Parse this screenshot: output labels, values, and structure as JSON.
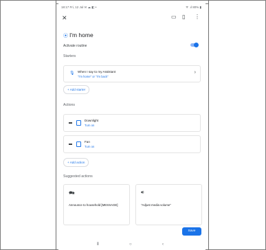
{
  "status_bar": {
    "left": "18:17  Fri, 12 Jul  ✉ ☁ ◧ •",
    "right": "ᯤ .ıl 80% ▮"
  },
  "toolbar": {
    "close_icon": "close-icon",
    "icons": [
      "cast-icon",
      "device-icon",
      "more-vert-icon"
    ]
  },
  "routine": {
    "title": "I'm home",
    "activate_label": "Activate routine",
    "activate_on": true,
    "toggle_color": "#1a73e8"
  },
  "starters": {
    "header": "Starters",
    "items": [
      {
        "title": "When I say to my Assistant",
        "subtitle": "\"I'm home\" or \"I'm back\""
      }
    ],
    "add_label": "+  Add starter"
  },
  "actions": {
    "header": "Actions",
    "items": [
      {
        "title": "Downlight",
        "subtitle": "Turn on"
      },
      {
        "title": "Fan",
        "subtitle": "Turn on"
      }
    ],
    "add_label": "+  Add action"
  },
  "suggested": {
    "header": "Suggested actions",
    "items": [
      {
        "text": "Announce to household [MESSAGE]"
      },
      {
        "text": "\"Adjust media volume\""
      }
    ]
  },
  "save_label": "Save",
  "nav": {
    "recents": "⦀",
    "home": "○",
    "back": "‹"
  },
  "colors": {
    "accent": "#1a73e8",
    "text": "#202124"
  }
}
